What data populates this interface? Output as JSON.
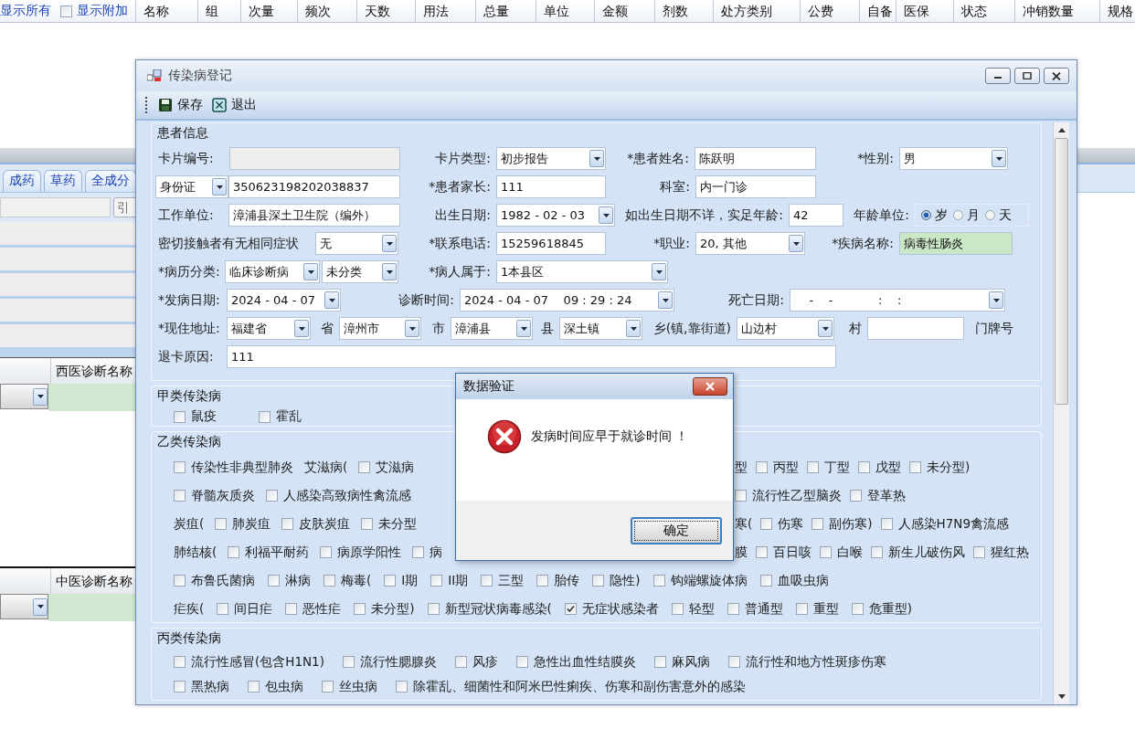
{
  "background": {
    "show_all": "显示所有",
    "show_extra": {
      "label": "显示附加",
      "checked": false
    },
    "columns": [
      "名称",
      "组",
      "次量",
      "频次",
      "天数",
      "用法",
      "总量",
      "单位",
      "金额",
      "剂数",
      "处方类别",
      "公费",
      "自备",
      "医保",
      "状态",
      "冲销数量",
      "规格"
    ],
    "tabs": [
      {
        "label": "成药",
        "selected": false
      },
      {
        "label": "草药",
        "selected": false
      },
      {
        "label": "全成分",
        "selected": false
      }
    ],
    "ref_button": "引",
    "western_dx_header": "西医诊断名称",
    "tcm_dx_header": "中医诊断名称"
  },
  "window": {
    "title": "传染病登记",
    "toolbar": [
      {
        "kind": "save",
        "label": "保存"
      },
      {
        "kind": "exit",
        "label": "退出"
      }
    ],
    "patient_info": {
      "title": "患者信息",
      "rows": [
        [
          {
            "kind": "label",
            "text": "卡片编号:"
          },
          {
            "kind": "input",
            "disabled": true
          },
          {
            "kind": "label",
            "text": "卡片类型:"
          },
          {
            "kind": "select",
            "value": "初步报告"
          },
          {
            "kind": "label",
            "text": "*患者姓名:"
          },
          {
            "kind": "input",
            "value": "陈跃明"
          },
          {
            "kind": "label",
            "text": "*性别:"
          },
          {
            "kind": "select",
            "value": "男"
          }
        ],
        [
          {
            "kind": "select",
            "value": "身份证"
          },
          {
            "kind": "input",
            "value": "350623198202038837"
          },
          {
            "kind": "label",
            "text": "*患者家长:"
          },
          {
            "kind": "input",
            "value": "111"
          },
          {
            "kind": "label",
            "text": "科室:"
          },
          {
            "kind": "input",
            "value": "内一门诊"
          }
        ],
        [
          {
            "kind": "label",
            "text": "工作单位:"
          },
          {
            "kind": "input",
            "value": "漳浦县深土卫生院（编外）"
          },
          {
            "kind": "label",
            "text": "出生日期:"
          },
          {
            "kind": "date",
            "value": "1982 - 02 - 03"
          },
          {
            "kind": "label",
            "text": "如出生日期不详，实足年龄:"
          },
          {
            "kind": "input",
            "value": "42"
          },
          {
            "kind": "label",
            "text": "年龄单位:"
          },
          {
            "kind": "radio",
            "options": [
              {
                "label": "岁",
                "selected": true
              },
              {
                "label": "月",
                "selected": false
              },
              {
                "label": "天",
                "selected": false
              }
            ]
          }
        ],
        [
          {
            "kind": "label",
            "text": "密切接触者有无相同症状"
          },
          {
            "kind": "select",
            "value": "无"
          },
          {
            "kind": "label",
            "text": "*联系电话:"
          },
          {
            "kind": "input",
            "value": "15259618845"
          },
          {
            "kind": "label",
            "text": "*职业:"
          },
          {
            "kind": "select",
            "value": "20, 其他"
          },
          {
            "kind": "label",
            "text": "*疾病名称:"
          },
          {
            "kind": "lookup",
            "value": "病毒性肠炎"
          }
        ],
        [
          {
            "kind": "label",
            "text": "*病历分类:"
          },
          {
            "kind": "select_pair",
            "values": [
              "临床诊断病",
              "未分类"
            ]
          },
          {
            "kind": "label",
            "text": "*病人属于:"
          },
          {
            "kind": "select",
            "value": "1本县区"
          }
        ]
      ],
      "date_row": [
        {
          "kind": "label",
          "text": "*发病日期:"
        },
        {
          "kind": "date",
          "value": "2024 - 04 - 07"
        },
        {
          "kind": "label",
          "text": "诊断时间:"
        },
        {
          "kind": "date",
          "value": "2024 - 04 - 07    09 : 29 : 24"
        },
        {
          "kind": "label",
          "text": "死亡日期:"
        },
        {
          "kind": "date",
          "value": "    -    -            :    :"
        }
      ],
      "address_row": [
        {
          "kind": "label",
          "text": "*现住地址:"
        },
        {
          "kind": "select",
          "value": "福建省"
        },
        {
          "kind": "label",
          "text": "省"
        },
        {
          "kind": "select",
          "value": "漳州市"
        },
        {
          "kind": "label",
          "text": "市"
        },
        {
          "kind": "select",
          "value": "漳浦县"
        },
        {
          "kind": "label",
          "text": "县"
        },
        {
          "kind": "select",
          "value": "深土镇"
        },
        {
          "kind": "label",
          "text": "乡(镇,靠街道)"
        },
        {
          "kind": "select",
          "value": "山边村"
        },
        {
          "kind": "label",
          "text": "村"
        },
        {
          "kind": "input"
        },
        {
          "kind": "label",
          "text": "门牌号"
        }
      ],
      "reason_row": [
        {
          "kind": "label",
          "text": "退卡原因:"
        },
        {
          "kind": "input",
          "value": "111"
        }
      ]
    },
    "class_a": {
      "title": "甲类传染病",
      "rows": [
        {
          "items": [
            {
              "kind": "check",
              "label": "鼠疫",
              "checked": false
            },
            {
              "kind": "check",
              "label": "霍乱",
              "checked": false
            }
          ]
        }
      ]
    },
    "class_b": {
      "title": "乙类传染病",
      "rows": [
        {
          "items": [
            {
              "kind": "check",
              "label": "传染性非典型肺炎",
              "checked": false
            },
            {
              "kind": "text",
              "label": "艾滋病("
            },
            {
              "kind": "check",
              "label": "艾滋病",
              "checked": false
            }
          ],
          "right": [
            {
              "kind": "text",
              "label": "型"
            },
            {
              "kind": "check",
              "label": "丙型",
              "checked": false
            },
            {
              "kind": "check",
              "label": "丁型",
              "checked": false
            },
            {
              "kind": "check",
              "label": "戊型",
              "checked": false
            },
            {
              "kind": "check",
              "label": "未分型)",
              "checked": false
            }
          ]
        },
        {
          "items": [
            {
              "kind": "check",
              "label": "脊髓灰质炎",
              "checked": false
            },
            {
              "kind": "check",
              "label": "人感染高致病性禽流感",
              "checked": false
            }
          ],
          "right": [
            {
              "kind": "check",
              "label": "流行性乙型脑炎",
              "checked": false
            },
            {
              "kind": "check",
              "label": "登革热",
              "checked": false
            }
          ]
        },
        {
          "items": [
            {
              "kind": "text",
              "label": "炭疽("
            },
            {
              "kind": "check",
              "label": "肺炭疽",
              "checked": false
            },
            {
              "kind": "check",
              "label": "皮肤炭疽",
              "checked": false
            },
            {
              "kind": "check",
              "label": "未分型",
              "checked": false
            }
          ],
          "right": [
            {
              "kind": "text",
              "label": "寒("
            },
            {
              "kind": "check",
              "label": "伤寒",
              "checked": false
            },
            {
              "kind": "check",
              "label": "副伤寒)",
              "checked": false
            },
            {
              "kind": "check",
              "label": "人感染H7N9禽流感",
              "checked": false
            }
          ]
        },
        {
          "items": [
            {
              "kind": "text",
              "label": "肺结核("
            },
            {
              "kind": "check",
              "label": "利福平耐药",
              "checked": false
            },
            {
              "kind": "check",
              "label": "病原学阳性",
              "checked": false
            },
            {
              "kind": "check",
              "label": "病",
              "checked": false
            }
          ],
          "right": [
            {
              "kind": "text",
              "label": "膜"
            },
            {
              "kind": "check",
              "label": "百日咳",
              "checked": false
            },
            {
              "kind": "check",
              "label": "白喉",
              "checked": false
            },
            {
              "kind": "check",
              "label": "新生儿破伤风",
              "checked": false
            },
            {
              "kind": "check",
              "label": "猩红热",
              "checked": false
            }
          ]
        },
        {
          "items": [
            {
              "kind": "check",
              "label": "布鲁氏菌病",
              "checked": false
            },
            {
              "kind": "check",
              "label": "淋病",
              "checked": false
            },
            {
              "kind": "check",
              "label": "梅毒(",
              "checked": false
            },
            {
              "kind": "check",
              "label": "I期",
              "checked": false
            },
            {
              "kind": "check",
              "label": "II期",
              "checked": false
            },
            {
              "kind": "check",
              "label": "三型",
              "checked": false
            },
            {
              "kind": "check",
              "label": "胎传",
              "checked": false
            },
            {
              "kind": "check",
              "label": "隐性)",
              "checked": false
            },
            {
              "kind": "check",
              "label": "钩端螺旋体病",
              "checked": false
            },
            {
              "kind": "check",
              "label": "血吸虫病",
              "checked": false
            }
          ]
        },
        {
          "items": [
            {
              "kind": "text",
              "label": "疟疾("
            },
            {
              "kind": "check",
              "label": "间日疟",
              "checked": false
            },
            {
              "kind": "check",
              "label": "恶性疟",
              "checked": false
            },
            {
              "kind": "check",
              "label": "未分型)",
              "checked": false
            },
            {
              "kind": "check",
              "label": "新型冠状病毒感染(",
              "checked": false
            },
            {
              "kind": "check",
              "label": "无症状感染者",
              "checked": true
            },
            {
              "kind": "check",
              "label": "轻型",
              "checked": false
            },
            {
              "kind": "check",
              "label": "普通型",
              "checked": false
            },
            {
              "kind": "check",
              "label": "重型",
              "checked": false
            },
            {
              "kind": "check",
              "label": "危重型)",
              "checked": false
            }
          ]
        }
      ]
    },
    "class_c": {
      "title": "丙类传染病",
      "rows": [
        {
          "items": [
            {
              "kind": "check",
              "label": "流行性感冒(包含H1N1)",
              "checked": false
            },
            {
              "kind": "check",
              "label": "流行性腮腺炎",
              "checked": false
            },
            {
              "kind": "check",
              "label": "风疹",
              "checked": false
            },
            {
              "kind": "check",
              "label": "急性出血性结膜炎",
              "checked": false
            },
            {
              "kind": "check",
              "label": "麻风病",
              "checked": false
            },
            {
              "kind": "check",
              "label": "流行性和地方性斑疹伤寒",
              "checked": false
            }
          ]
        },
        {
          "items": [
            {
              "kind": "check",
              "label": "黑热病",
              "checked": false
            },
            {
              "kind": "check",
              "label": "包虫病",
              "checked": false
            },
            {
              "kind": "check",
              "label": "丝虫病",
              "checked": false
            },
            {
              "kind": "check",
              "label": "除霍乱、细菌性和阿米巴性痢疾、伤寒和副伤害意外的感染",
              "checked": false
            }
          ]
        }
      ]
    }
  },
  "dialog": {
    "title": "数据验证",
    "message": "发病时间应早于就诊时间 ！",
    "button": "确定"
  }
}
